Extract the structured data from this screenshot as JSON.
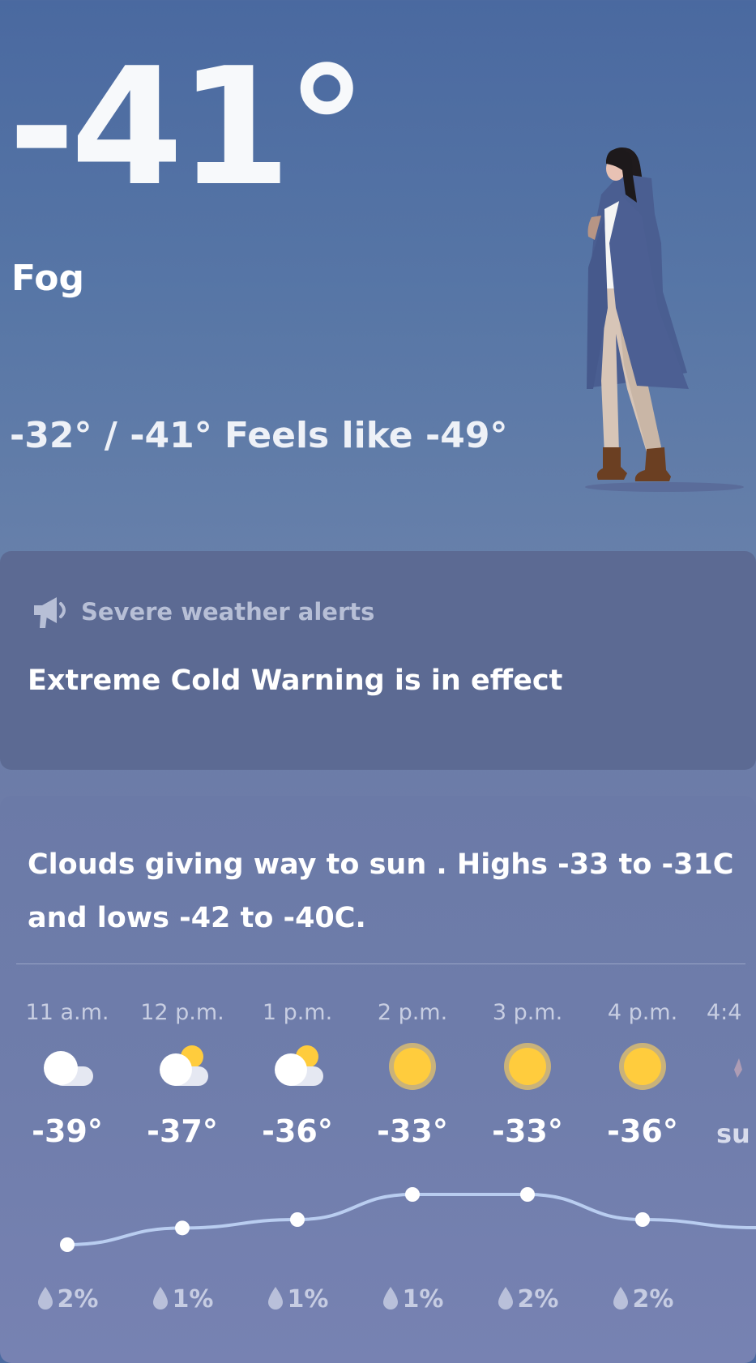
{
  "current": {
    "temperature": "-41°",
    "condition": "Fog",
    "high_low_feels": "-32° / -41° Feels like -49°"
  },
  "alert": {
    "title": "Severe weather alerts",
    "text": "Extreme Cold Warning is in effect"
  },
  "forecast": {
    "summary": "Clouds giving way to sun . Highs -33 to -31C and lows -42 to -40C.",
    "hours": [
      {
        "time": "11 a.m.",
        "icon": "cloudy-icon",
        "temp": "-39°",
        "temp_value": -39,
        "precip": "2%"
      },
      {
        "time": "12 p.m.",
        "icon": "partly-sunny-icon",
        "temp": "-37°",
        "temp_value": -37,
        "precip": "1%"
      },
      {
        "time": "1 p.m.",
        "icon": "partly-sunny-icon",
        "temp": "-36°",
        "temp_value": -36,
        "precip": "1%"
      },
      {
        "time": "2 p.m.",
        "icon": "sunny-icon",
        "temp": "-33°",
        "temp_value": -33,
        "precip": "1%"
      },
      {
        "time": "3 p.m.",
        "icon": "sunny-icon",
        "temp": "-33°",
        "temp_value": -33,
        "precip": "2%"
      },
      {
        "time": "4 p.m.",
        "icon": "sunny-icon",
        "temp": "-36°",
        "temp_value": -36,
        "precip": "2%"
      }
    ],
    "partial": {
      "time": "4:4",
      "text": "su"
    }
  },
  "colors": {
    "sun": "#ffcc3d",
    "sun_halo": "#c9b27a",
    "cloud": "#ffffff",
    "curve": "#b9cdf0",
    "alert_bg": "#5c6a93"
  }
}
